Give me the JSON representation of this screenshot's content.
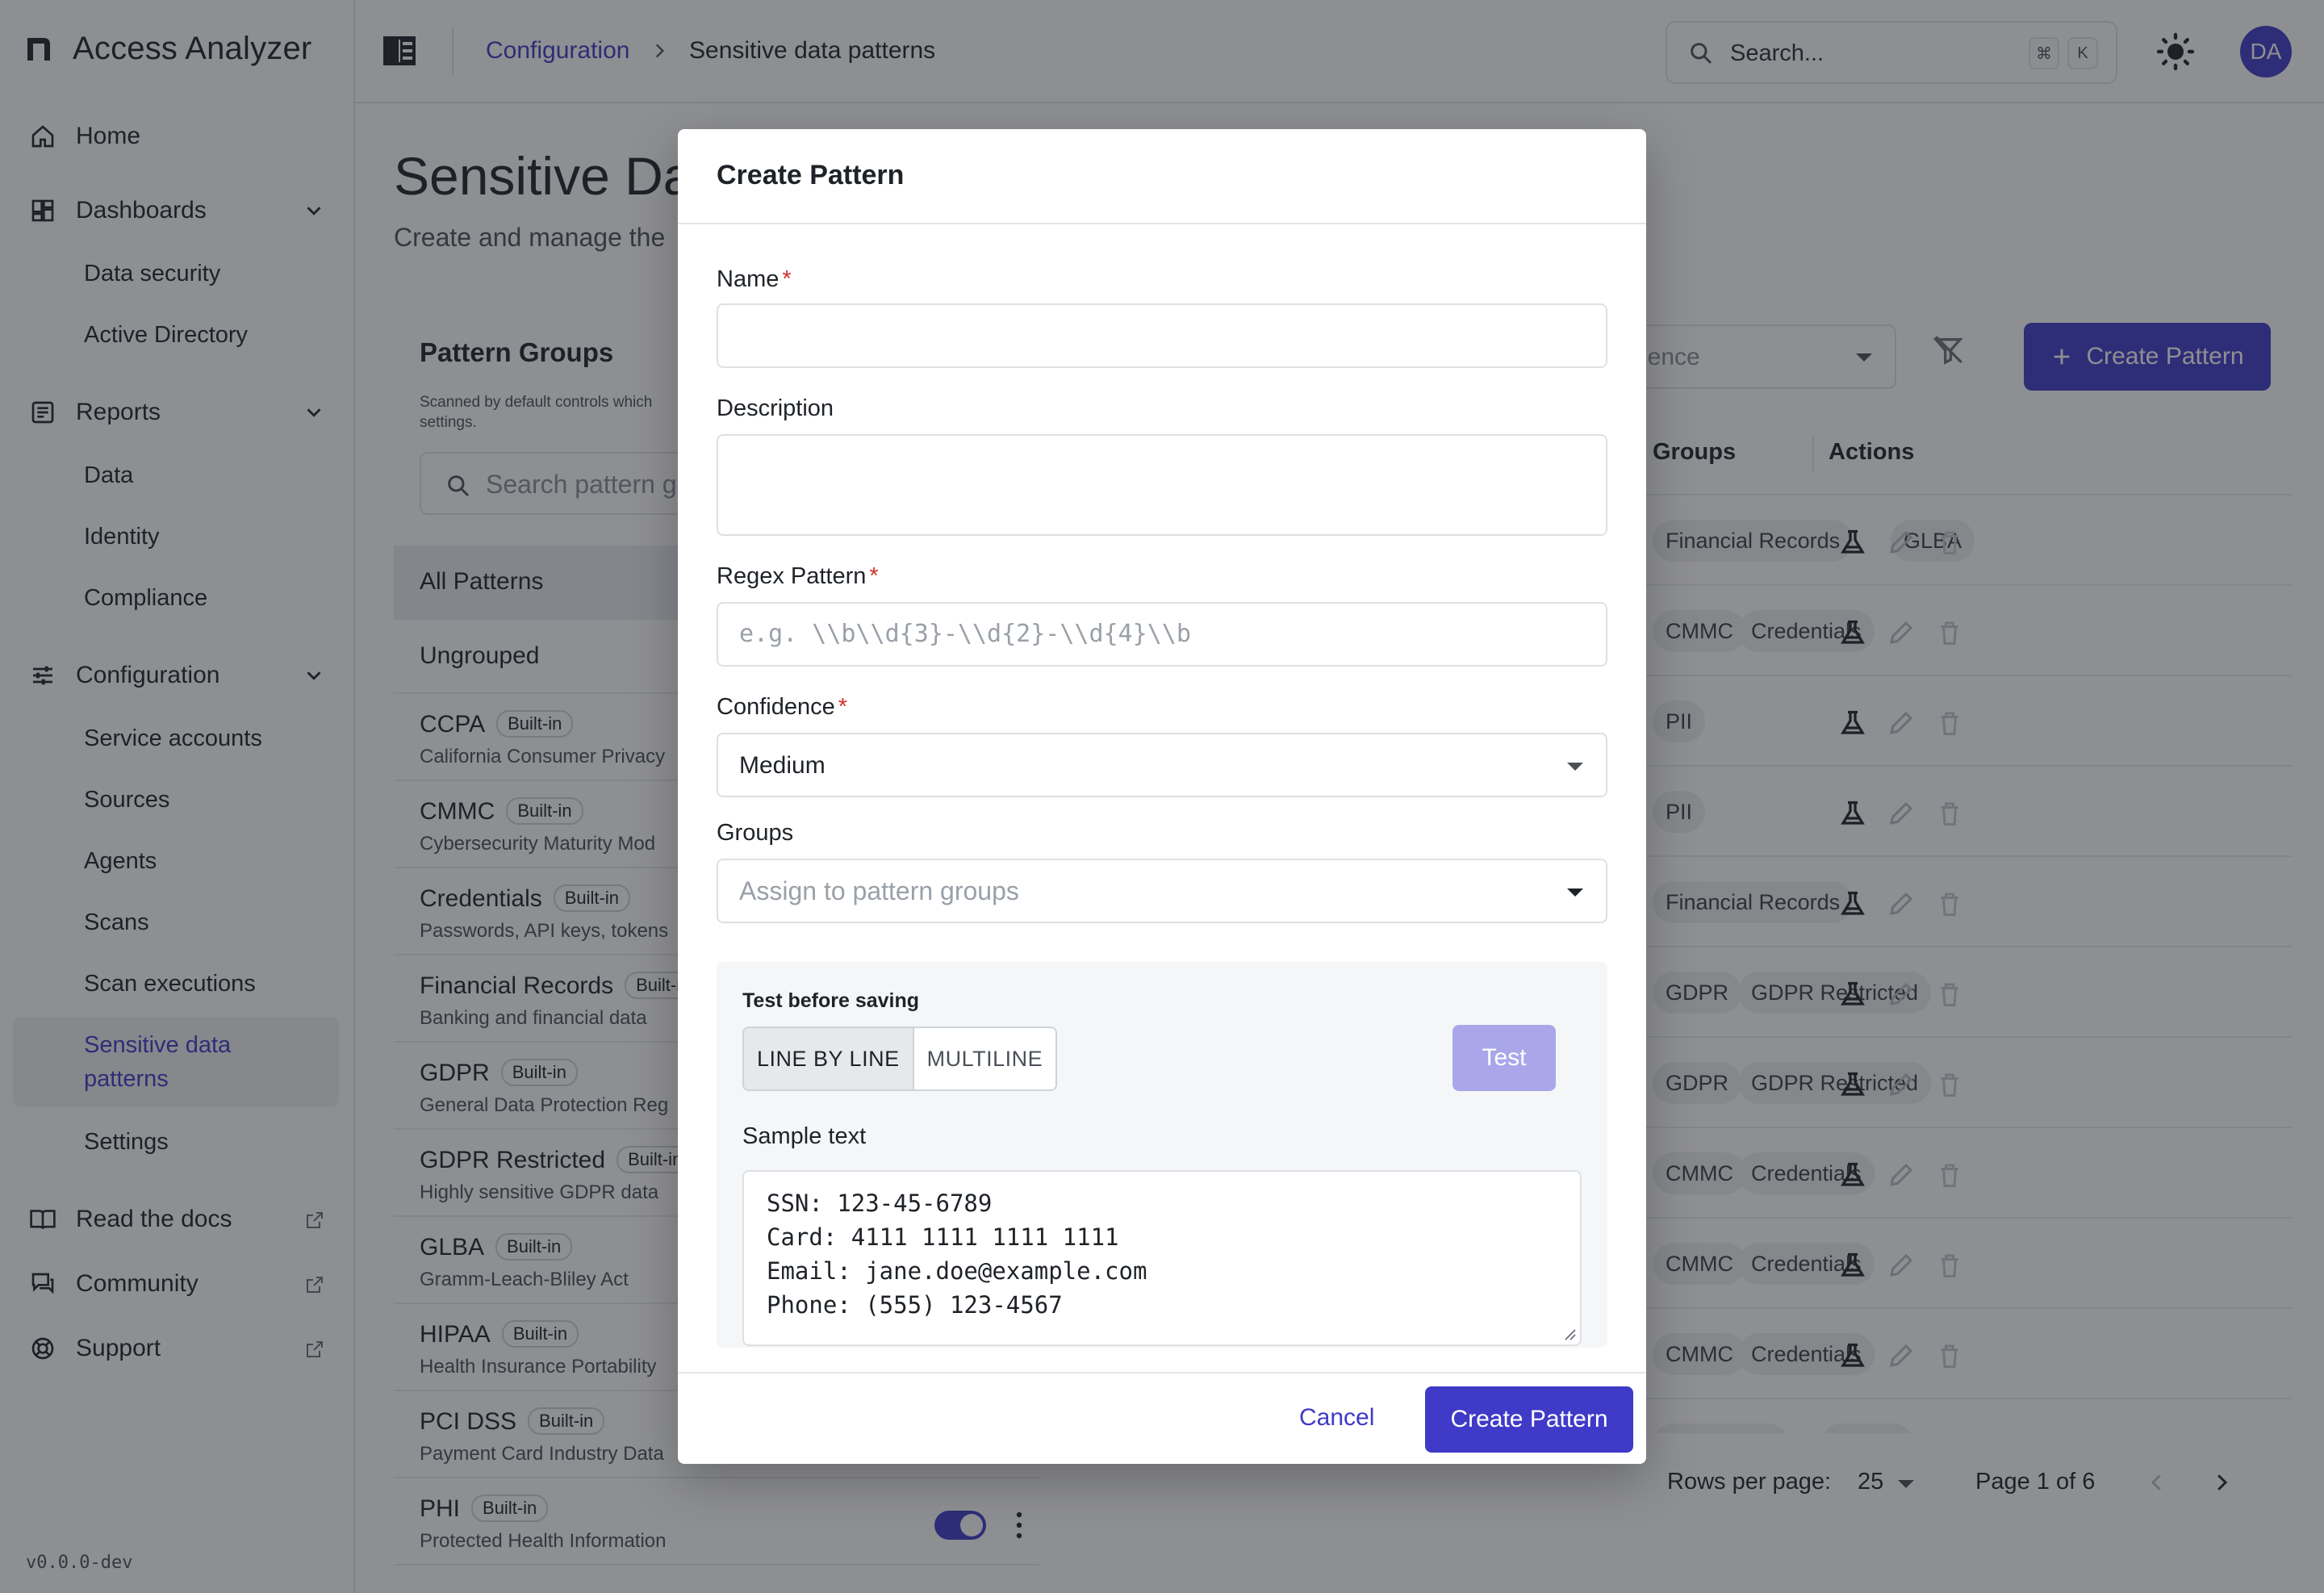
{
  "app": {
    "title": "Access Analyzer",
    "version": "v0.0.0-dev"
  },
  "sidebar": {
    "home": "Home",
    "dashboards": {
      "label": "Dashboards",
      "items": [
        "Data security",
        "Active Directory"
      ]
    },
    "reports": {
      "label": "Reports",
      "items": [
        "Data",
        "Identity",
        "Compliance"
      ]
    },
    "configuration": {
      "label": "Configuration",
      "items": [
        "Service accounts",
        "Sources",
        "Agents",
        "Scans",
        "Scan executions",
        "Sensitive data patterns",
        "Settings"
      ],
      "active": "Sensitive data patterns"
    },
    "links": [
      "Read the docs",
      "Community",
      "Support"
    ]
  },
  "topbar": {
    "breadcrumb": {
      "parent": "Configuration",
      "current": "Sensitive data patterns"
    },
    "search_placeholder": "Search...",
    "shortcut": [
      "⌘",
      "K"
    ],
    "avatar_initials": "DA"
  },
  "page": {
    "title": "Sensitive Da",
    "subtitle": "Create and manage the"
  },
  "groups_panel": {
    "title": "Pattern Groups",
    "note": "Scanned by default controls which settings.",
    "search_placeholder": "Search pattern g",
    "all": "All Patterns",
    "ungrouped": "Ungrouped",
    "badge": "Built-in",
    "items": [
      {
        "name": "CCPA",
        "desc": "California Consumer Privacy"
      },
      {
        "name": "CMMC",
        "desc": "Cybersecurity Maturity Mod"
      },
      {
        "name": "Credentials",
        "desc": "Passwords, API keys, tokens"
      },
      {
        "name": "Financial Records",
        "desc": "Banking and financial data"
      },
      {
        "name": "GDPR",
        "desc": "General Data Protection Reg"
      },
      {
        "name": "GDPR Restricted",
        "desc": "Highly sensitive GDPR data"
      },
      {
        "name": "GLBA",
        "desc": "Gramm-Leach-Bliley Act"
      },
      {
        "name": "HIPAA",
        "desc": "Health Insurance Portability"
      },
      {
        "name": "PCI DSS",
        "desc": "Payment Card Industry Data"
      },
      {
        "name": "PHI",
        "desc": "Protected Health Information"
      }
    ]
  },
  "toolbar": {
    "confidence_placeholder": "fidence",
    "create_label": "Create Pattern"
  },
  "table": {
    "headers": {
      "groups": "Groups",
      "actions": "Actions"
    },
    "rows": [
      [
        "Financial Records",
        "GLBA"
      ],
      [
        "CMMC",
        "Credentials"
      ],
      [
        "PII"
      ],
      [
        "PII"
      ],
      [
        "Financial Records"
      ],
      [
        "GDPR",
        "GDPR Restricted"
      ],
      [
        "GDPR",
        "GDPR Restricted"
      ],
      [
        "CMMC",
        "Credentials"
      ],
      [
        "CMMC",
        "Credentials"
      ],
      [
        "CMMC",
        "Credentials"
      ],
      [
        "Credentials",
        "CMMC"
      ]
    ]
  },
  "pagination": {
    "rows_label": "Rows per page:",
    "rows_value": "25",
    "page_text": "Page 1 of 6"
  },
  "modal": {
    "title": "Create Pattern",
    "name_label": "Name",
    "description_label": "Description",
    "regex_label": "Regex Pattern",
    "regex_placeholder": "e.g. \\\\b\\\\d{3}-\\\\d{2}-\\\\d{4}\\\\b",
    "confidence_label": "Confidence",
    "confidence_value": "Medium",
    "groups_label": "Groups",
    "groups_placeholder": "Assign to pattern groups",
    "test": {
      "title": "Test before saving",
      "modes": [
        "LINE BY LINE",
        "MULTILINE"
      ],
      "selected_mode": "LINE BY LINE",
      "button": "Test",
      "sample_label": "Sample text",
      "sample_lines": [
        "SSN: 123-45-6789",
        "Card: 4111 1111 1111 1111",
        "Email: jane.doe@example.com",
        "Phone: (555) 123-4567"
      ]
    },
    "cancel": "Cancel",
    "submit": "Create Pattern"
  },
  "colors": {
    "accent": "#3f3ac8",
    "accent_disabled": "#a9a7ea",
    "required": "#d0312d"
  }
}
